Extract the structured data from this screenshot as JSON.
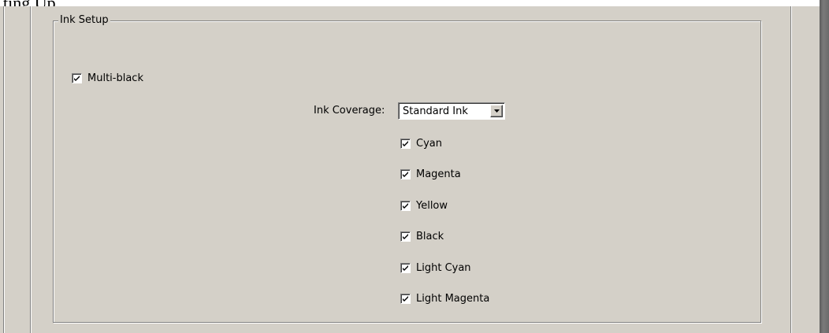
{
  "page_title": "ting Up",
  "group": {
    "legend": "Ink Setup"
  },
  "multi_black": {
    "label": "Multi-black",
    "checked": true
  },
  "ink_coverage": {
    "label": "Ink Coverage:",
    "selected": "Standard Ink"
  },
  "inks": [
    {
      "label": "Cyan",
      "checked": true
    },
    {
      "label": "Magenta",
      "checked": true
    },
    {
      "label": "Yellow",
      "checked": true
    },
    {
      "label": "Black",
      "checked": true
    },
    {
      "label": "Light Cyan",
      "checked": true
    },
    {
      "label": "Light Magenta",
      "checked": true
    }
  ],
  "icons": {
    "check": "check-icon",
    "dropdown": "chevron-down-icon"
  }
}
